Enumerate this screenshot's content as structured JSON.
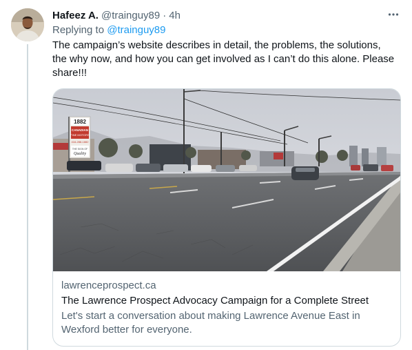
{
  "tweet": {
    "author_name": "Hafeez A.",
    "author_handle": "@trainguy89",
    "separator": "·",
    "timestamp": "4h",
    "replying_to_label": "Replying to",
    "replying_to_handle": "@trainguy89",
    "text": "The campaign’s website describes in detail, the problems, the solutions, the why now, and how you can get involved as I can’t do this alone. Please share!!!"
  },
  "card": {
    "domain": "lawrenceprospect.ca",
    "title": "The Lawrence Prospect Advocacy Campaign for a Complete Street",
    "description": "Let's start a conversation about making Lawrence Avenue East in Wexford better for everyone.",
    "image_sign": {
      "number": "1882",
      "line1": "CANADIAN",
      "line2": "FINE MOTORS",
      "phone": "416-288-1882",
      "line3": "THE SIGN OF",
      "line4": "Quality"
    }
  },
  "icons": {
    "more": "more-horizontal-icon"
  },
  "colors": {
    "link": "#1d9bf0",
    "secondary_text": "#536471",
    "border": "#cfd9de"
  }
}
